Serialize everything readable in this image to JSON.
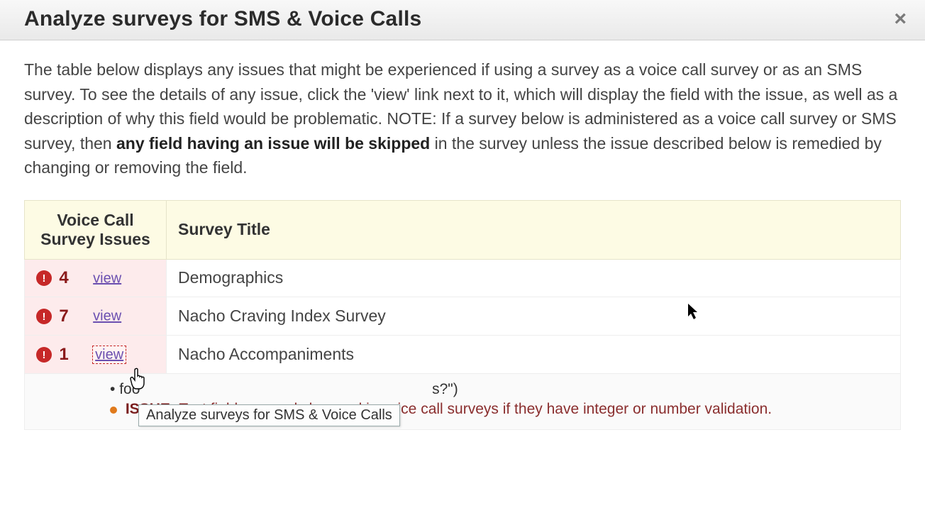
{
  "dialog": {
    "title": "Analyze surveys for SMS & Voice Calls",
    "close_glyph": "×"
  },
  "intro": {
    "pre": "The table below displays any issues that might be experienced if using a survey as a voice call survey or as an SMS survey. To see the details of any issue, click the 'view' link next to it, which will display the field with the issue, as well as a description of why this field would be problematic. NOTE: If a survey below is administered as a voice call survey or SMS survey, then ",
    "bold": "any field having an issue will be skipped",
    "post": " in the survey unless the issue described below is remedied by changing or removing the field."
  },
  "table": {
    "headers": {
      "issues": "Voice Call Survey Issues",
      "title": "Survey Title"
    },
    "view_label": "view",
    "alert_glyph": "!",
    "rows": [
      {
        "count": "4",
        "title": "Demographics"
      },
      {
        "count": "7",
        "title": "Nacho Craving Index Survey"
      },
      {
        "count": "1",
        "title": "Nacho Accompaniments"
      }
    ],
    "detail": {
      "bullet": "•",
      "field_fragment_pre": "foo",
      "field_fragment_post": "s?\")",
      "issue_label": "ISSUE:",
      "issue_text": " Text fields can only be used in voice call surveys if they have integer or number validation."
    }
  },
  "tooltip": {
    "text": "Analyze surveys for SMS & Voice Calls"
  }
}
